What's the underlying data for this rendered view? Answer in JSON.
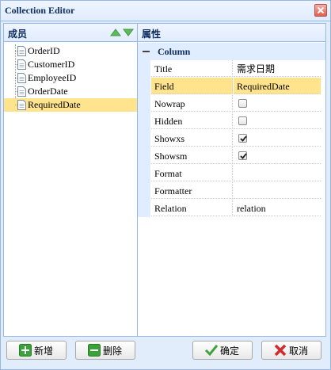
{
  "window": {
    "title": "Collection Editor"
  },
  "members_panel": {
    "title": "成员",
    "items": [
      {
        "label": "OrderID",
        "selected": false
      },
      {
        "label": "CustomerID",
        "selected": false
      },
      {
        "label": "EmployeeID",
        "selected": false
      },
      {
        "label": "OrderDate",
        "selected": false
      },
      {
        "label": "RequiredDate",
        "selected": true
      }
    ]
  },
  "properties_panel": {
    "title": "属性",
    "group": "Column",
    "rows": [
      {
        "name": "Title",
        "value": "需求日期"
      },
      {
        "name": "Field",
        "value": "RequiredDate"
      },
      {
        "name": "Nowrap",
        "checked": false
      },
      {
        "name": "Hidden",
        "checked": false
      },
      {
        "name": "Showxs",
        "checked": true
      },
      {
        "name": "Showsm",
        "checked": true
      },
      {
        "name": "Format",
        "value": ""
      },
      {
        "name": "Formatter",
        "value": ""
      },
      {
        "name": "Relation",
        "value": "relation"
      }
    ]
  },
  "footer": {
    "add_label": "新增",
    "delete_label": "删除",
    "ok_label": "确定",
    "cancel_label": "取消"
  },
  "colors": {
    "accent_border": "#95b8e7",
    "header_bg": "#e0ecff",
    "selection": "#ffe48d",
    "arrow_green": "#5fb95f"
  }
}
